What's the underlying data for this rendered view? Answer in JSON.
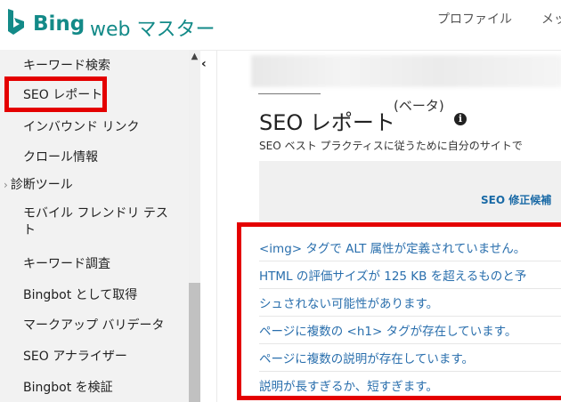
{
  "header": {
    "logo_bing": "Bing",
    "logo_web": "web マスター",
    "nav": [
      "プロファイル",
      "メッ"
    ],
    "brand_color": "#138a88"
  },
  "sidebar": {
    "items": [
      {
        "label": "キーワード検索"
      },
      {
        "label": "SEO レポート",
        "selected": true
      },
      {
        "label": "インバウンド リンク"
      },
      {
        "label": "クロール情報"
      },
      {
        "label": "診断ツール",
        "group": true
      },
      {
        "label": "モバイル フレンドリ テスト"
      },
      {
        "label": "キーワード調査"
      },
      {
        "label": "Bingbot として取得"
      },
      {
        "label": "マークアップ バリデータ"
      },
      {
        "label": "SEO アナライザー"
      },
      {
        "label": "Bingbot を検証"
      }
    ],
    "scroll_up_icon": "▲",
    "collapse_icon": "‹",
    "group_icon": "›"
  },
  "main": {
    "title": "SEO レポート",
    "beta": "(ベータ)",
    "info_icon": "i",
    "subtitle": "SEO ベスト プラクティスに従うために自分のサイトで",
    "table_header": "SEO 修正候補",
    "issues": [
      "<img> タグで ALT 属性が定義されていません。",
      "HTML の評価サイズが 125 KB を超えるものと予",
      "シュされない可能性があります。",
      "ページに複数の <h1> タグが存在しています。",
      "ページに複数の説明が存在しています。",
      "説明が長すぎるか、短すぎます。"
    ],
    "link_color": "#2a6fad"
  },
  "highlight_color": "#e40000"
}
